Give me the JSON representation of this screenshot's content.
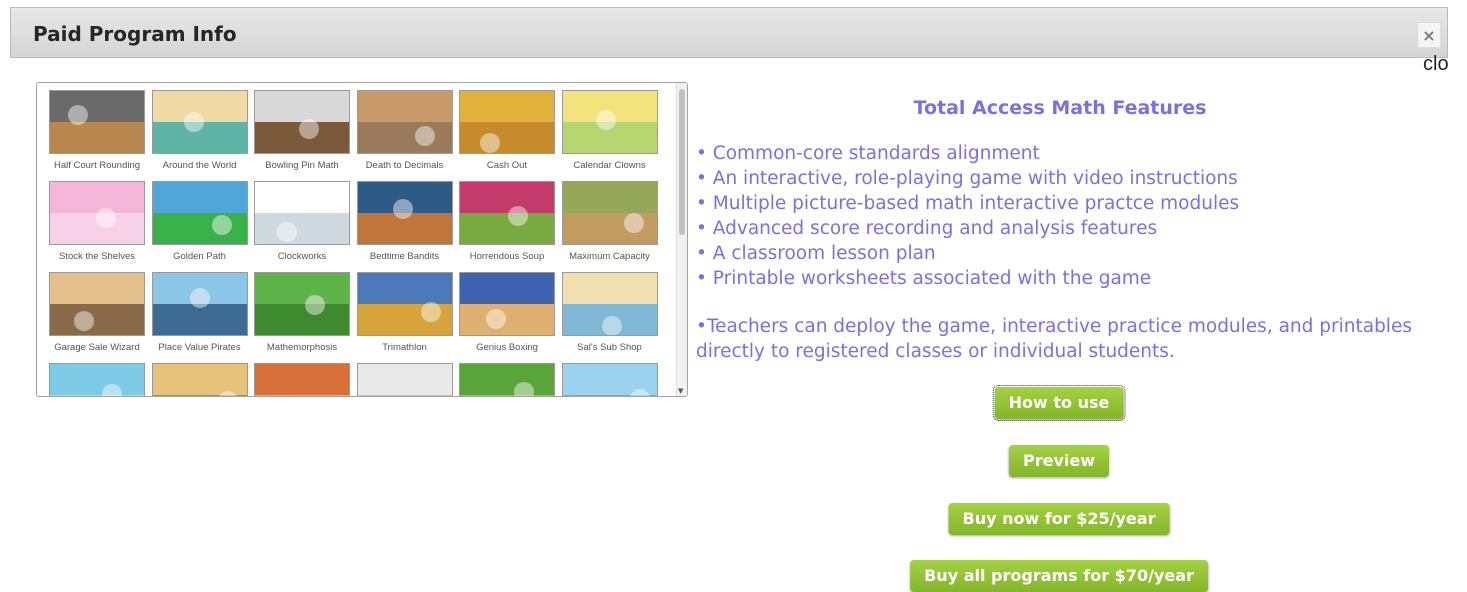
{
  "dialog": {
    "title": "Paid Program Info",
    "close_symbol": "×",
    "close_text": "clo"
  },
  "gallery": {
    "games": [
      {
        "label": "Half Court Rounding",
        "colors": [
          "#6a6a6a",
          "#b8874d"
        ]
      },
      {
        "label": "Around the World",
        "colors": [
          "#f1d9a6",
          "#5fb4a8"
        ]
      },
      {
        "label": "Bowling Pin Math",
        "colors": [
          "#d9d9d9",
          "#7a5a3a"
        ]
      },
      {
        "label": "Death to Decimals",
        "colors": [
          "#c89a6a",
          "#9a7a5a"
        ]
      },
      {
        "label": "Cash Out",
        "colors": [
          "#e2b33b",
          "#c58b2a"
        ]
      },
      {
        "label": "Calendar Clowns",
        "colors": [
          "#f2e37a",
          "#b6d672"
        ]
      },
      {
        "label": "Stock the Shelves",
        "colors": [
          "#f3b6d8",
          "#f7d1e8"
        ]
      },
      {
        "label": "Golden Path",
        "colors": [
          "#4ea7d8",
          "#39b149"
        ]
      },
      {
        "label": "Clockworks",
        "colors": [
          "#ffffff",
          "#cfd9e0"
        ]
      },
      {
        "label": "Bedtime Bandits",
        "colors": [
          "#2c5b86",
          "#c0763a"
        ]
      },
      {
        "label": "Horrendous Soup",
        "colors": [
          "#c23b6a",
          "#79aa3f"
        ]
      },
      {
        "label": "Maximum Capacity",
        "colors": [
          "#95a85a",
          "#c19b5f"
        ]
      },
      {
        "label": "Garage Sale Wizard",
        "colors": [
          "#e6c08a",
          "#8b6a4a"
        ]
      },
      {
        "label": "Place Value Pirates",
        "colors": [
          "#8bc6e8",
          "#3c6c94"
        ]
      },
      {
        "label": "Mathemorphosis",
        "colors": [
          "#5db54a",
          "#3d8a2f"
        ]
      },
      {
        "label": "Trimathlon",
        "colors": [
          "#4a78b8",
          "#d6a43a"
        ]
      },
      {
        "label": "Genius Boxing",
        "colors": [
          "#3e63b1",
          "#e0b070"
        ]
      },
      {
        "label": "Sal's Sub Shop",
        "colors": [
          "#f2dfb0",
          "#7fb9d6"
        ]
      },
      {
        "label": "",
        "colors": [
          "#7ecbe8",
          "#e9d46a"
        ]
      },
      {
        "label": "",
        "colors": [
          "#e6c27a",
          "#b48a5a"
        ]
      },
      {
        "label": "",
        "colors": [
          "#d9703a",
          "#e8b05a"
        ]
      },
      {
        "label": "",
        "colors": [
          "#e9e9e9",
          "#b9c7d3"
        ]
      },
      {
        "label": "",
        "colors": [
          "#5aa53a",
          "#8bc95a"
        ]
      },
      {
        "label": "",
        "colors": [
          "#9bd3ee",
          "#6cb0d9"
        ]
      }
    ]
  },
  "features": {
    "title": "Total Access Math Features",
    "items": [
      "• Common-core standards alignment",
      "• An interactive, role-playing game with video instructions",
      "• Multiple picture-based math interactive practce modules",
      "• Advanced score recording and analysis features",
      "• A classroom lesson plan",
      "• Printable worksheets associated with the game"
    ],
    "teachers_note": "•Teachers can deploy the game, interactive practice modules, and printables directly to registered classes or individual students."
  },
  "buttons": {
    "how_to_use": "How to use",
    "preview": "Preview",
    "buy_now": "Buy now for $25/year",
    "buy_all": "Buy all programs for $70/year"
  },
  "colors": {
    "accent_text": "#7f6ce9",
    "button_green": "#93c336"
  }
}
